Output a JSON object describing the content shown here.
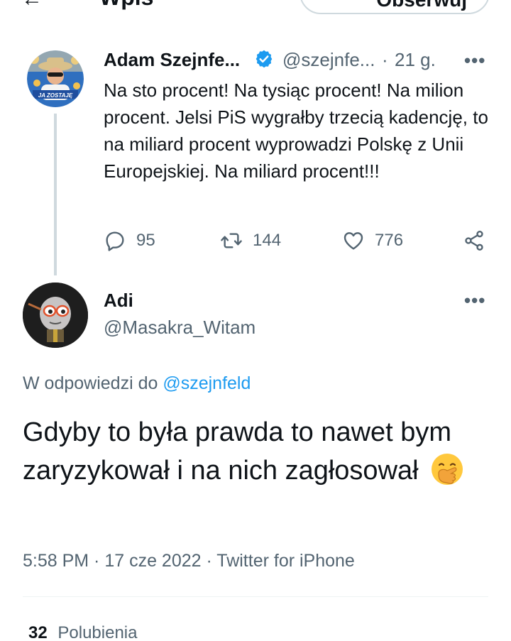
{
  "top_bar": {
    "title": "Wpis",
    "follow_label": "Obserwuj"
  },
  "parent_tweet": {
    "display_name": "Adam Szejnfe...",
    "handle": "@szejnfe...",
    "separator": "·",
    "time_ago": "21 g.",
    "text": "Na sto procent! Na tysiąc procent! Na milion procent. Jelsi PiS wygrałby trzecią kadencję, to na miliard procent wyprowadzi Polskę z Unii Europejskiej. Na miliard procent!!!",
    "avatar_text": "JA ZOSTAJĘ",
    "replies": "95",
    "retweets": "144",
    "likes": "776",
    "verified": true
  },
  "reply_tweet": {
    "display_name": "Adi",
    "handle": "@Masakra_Witam",
    "reply_prefix": "W odpowiedzi do",
    "reply_mention": "@szejnfeld",
    "text": "Gdyby to była prawda to nawet bym zaryzykował i na nich zagłosował",
    "emoji_icon": "face-with-hand-over-mouth-icon",
    "meta": "5:58 PM · 17 cze 2022 · Twitter for iPhone",
    "like_count": "32",
    "like_label": "Polubienia"
  },
  "colors": {
    "primary_text": "#0f1419",
    "secondary_text": "#536471",
    "accent": "#1d9bf0",
    "thread_line": "#cfd9de"
  }
}
